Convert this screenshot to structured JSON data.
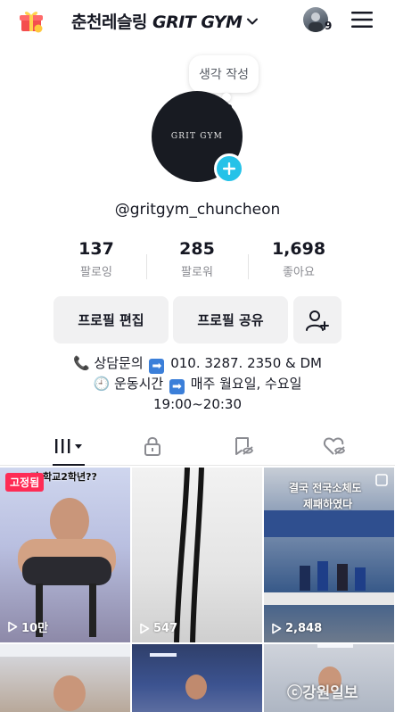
{
  "header": {
    "title_prefix": "춘천레슬링 ",
    "title_brand": "GRIT GYM",
    "notification_count": "9"
  },
  "bubble": {
    "text": "생각 작성"
  },
  "profile": {
    "logo_text": "GRIT GYM",
    "username": "@gritgym_chuncheon"
  },
  "stats": [
    {
      "value": "137",
      "label": "팔로잉"
    },
    {
      "value": "285",
      "label": "팔로워"
    },
    {
      "value": "1,698",
      "label": "좋아요"
    }
  ],
  "buttons": {
    "edit_profile": "프로필 편집",
    "share_profile": "프로필 공유"
  },
  "bio": {
    "line1_emoji": "📞",
    "line1_a": "상담문의",
    "line1_b": "010. 3287. 2350 & DM",
    "line2_emoji": "🕘",
    "line2_a": "운동시간",
    "line2_b": "매주 월요일, 수요일",
    "line3": "19:00~20:30"
  },
  "videos": [
    {
      "views": "10만",
      "pinned_label": "고정됨",
      "caption": "자 학교2학년??"
    },
    {
      "views": "547"
    },
    {
      "views": "2,848",
      "caption": "결국 전국소체도",
      "caption2": "제패하였다"
    }
  ],
  "watermark": "ⓒ강원일보",
  "colors": {
    "accent": "#25c2e8",
    "pin": "#fe2c55",
    "text": "#161823",
    "secondary": "#8a8b91",
    "button_bg": "#f1f1f2"
  }
}
